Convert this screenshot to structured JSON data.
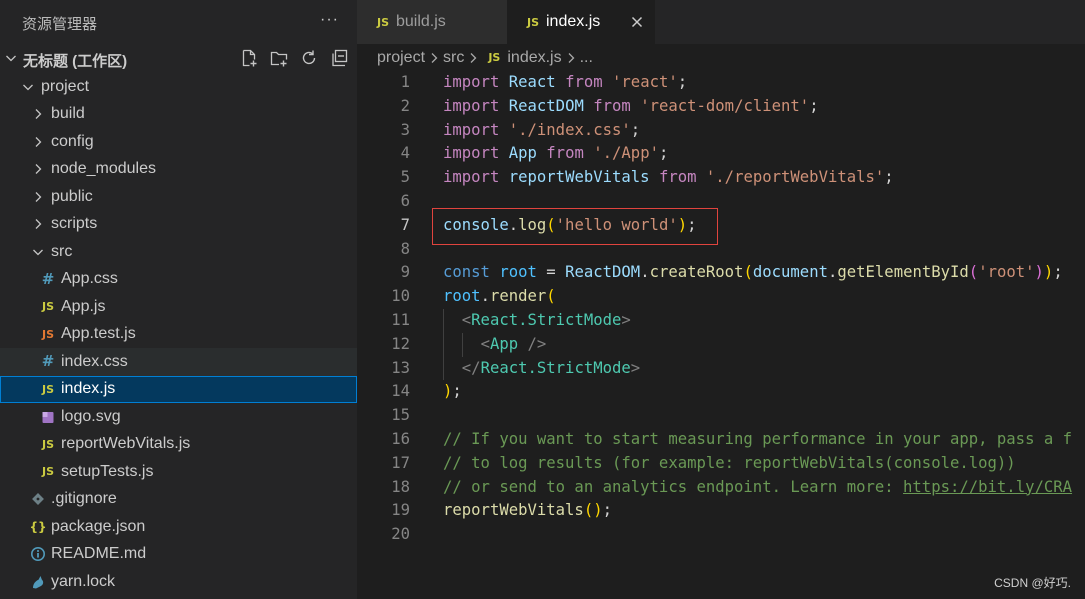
{
  "sidebar": {
    "title": "资源管理器",
    "more_label": "···",
    "workspace": {
      "label": "无标题 (工作区)",
      "expanded_icon": "chevron-down-icon",
      "actions": [
        "new-file-icon",
        "new-folder-icon",
        "refresh-icon",
        "collapse-all-icon"
      ]
    },
    "tree": [
      {
        "label": "project",
        "depth": 0,
        "icon": "chevron-down-icon"
      },
      {
        "label": "build",
        "depth": 1,
        "icon": "chevron-right-icon"
      },
      {
        "label": "config",
        "depth": 1,
        "icon": "chevron-right-icon"
      },
      {
        "label": "node_modules",
        "depth": 1,
        "icon": "chevron-right-icon"
      },
      {
        "label": "public",
        "depth": 1,
        "icon": "chevron-right-icon"
      },
      {
        "label": "scripts",
        "depth": 1,
        "icon": "chevron-right-icon"
      },
      {
        "label": "src",
        "depth": 1,
        "icon": "chevron-down-icon"
      },
      {
        "label": "App.css",
        "depth": 2,
        "icon": "css-icon"
      },
      {
        "label": "App.js",
        "depth": 2,
        "icon": "js-icon"
      },
      {
        "label": "App.test.js",
        "depth": 2,
        "icon": "js-test-icon"
      },
      {
        "label": "index.css",
        "depth": 2,
        "icon": "css-icon",
        "hovered": true
      },
      {
        "label": "index.js",
        "depth": 2,
        "icon": "js-icon",
        "selected": true
      },
      {
        "label": "logo.svg",
        "depth": 2,
        "icon": "svg-file-icon"
      },
      {
        "label": "reportWebVitals.js",
        "depth": 2,
        "icon": "js-icon"
      },
      {
        "label": "setupTests.js",
        "depth": 2,
        "icon": "js-icon"
      },
      {
        "label": ".gitignore",
        "depth": 1,
        "icon": "git-icon"
      },
      {
        "label": "package.json",
        "depth": 1,
        "icon": "json-icon"
      },
      {
        "label": "README.md",
        "depth": 1,
        "icon": "info-icon"
      },
      {
        "label": "yarn.lock",
        "depth": 1,
        "icon": "yarn-icon"
      }
    ]
  },
  "editor": {
    "tabs": [
      {
        "label": "build.js",
        "icon": "js-icon",
        "active": false
      },
      {
        "label": "index.js",
        "icon": "js-icon",
        "active": true
      }
    ],
    "breadcrumb": [
      {
        "label": "project"
      },
      {
        "label": "src"
      },
      {
        "label": "index.js",
        "icon": "js-icon"
      },
      {
        "label": "..."
      }
    ],
    "lines": [
      {
        "number": 1,
        "tokens": [
          [
            "import",
            "#c586c0"
          ],
          [
            " "
          ],
          [
            "React",
            "#9cdcfe"
          ],
          [
            " "
          ],
          [
            "from",
            "#c586c0"
          ],
          [
            " "
          ],
          [
            "'react'",
            "#ce9178"
          ],
          [
            ";"
          ]
        ]
      },
      {
        "number": 2,
        "tokens": [
          [
            "import",
            "#c586c0"
          ],
          [
            " "
          ],
          [
            "ReactDOM",
            "#9cdcfe"
          ],
          [
            " "
          ],
          [
            "from",
            "#c586c0"
          ],
          [
            " "
          ],
          [
            "'react-dom/client'",
            "#ce9178"
          ],
          [
            ";"
          ]
        ]
      },
      {
        "number": 3,
        "tokens": [
          [
            "import",
            "#c586c0"
          ],
          [
            " "
          ],
          [
            "'./index.css'",
            "#ce9178"
          ],
          [
            ";"
          ]
        ]
      },
      {
        "number": 4,
        "tokens": [
          [
            "import",
            "#c586c0"
          ],
          [
            " "
          ],
          [
            "App",
            "#9cdcfe"
          ],
          [
            " "
          ],
          [
            "from",
            "#c586c0"
          ],
          [
            " "
          ],
          [
            "'./App'",
            "#ce9178"
          ],
          [
            ";"
          ]
        ]
      },
      {
        "number": 5,
        "tokens": [
          [
            "import",
            "#c586c0"
          ],
          [
            " "
          ],
          [
            "reportWebVitals",
            "#9cdcfe"
          ],
          [
            " "
          ],
          [
            "from",
            "#c586c0"
          ],
          [
            " "
          ],
          [
            "'./reportWebVitals'",
            "#ce9178"
          ],
          [
            ";"
          ]
        ]
      },
      {
        "number": 6,
        "tokens": []
      },
      {
        "number": 7,
        "active": true,
        "tokens": [
          [
            "console",
            "#9cdcfe"
          ],
          [
            "."
          ],
          [
            "log",
            "#dcdcaa"
          ],
          [
            "(",
            "#ffd700"
          ],
          [
            "'hello world'",
            "#ce9178"
          ],
          [
            ")",
            "#ffd700"
          ],
          [
            ";"
          ]
        ]
      },
      {
        "number": 8,
        "tokens": []
      },
      {
        "number": 9,
        "tokens": [
          [
            "const",
            "#569cd6"
          ],
          [
            " "
          ],
          [
            "root",
            "#4fc1ff"
          ],
          [
            " = "
          ],
          [
            "ReactDOM",
            "#9cdcfe"
          ],
          [
            "."
          ],
          [
            "createRoot",
            "#dcdcaa"
          ],
          [
            "(",
            "#ffd700"
          ],
          [
            "document",
            "#9cdcfe"
          ],
          [
            "."
          ],
          [
            "getElementById",
            "#dcdcaa"
          ],
          [
            "(",
            "#da70d6"
          ],
          [
            "'root'",
            "#ce9178"
          ],
          [
            ")",
            "#da70d6"
          ],
          [
            ")",
            "#ffd700"
          ],
          [
            ";"
          ]
        ]
      },
      {
        "number": 10,
        "tokens": [
          [
            "root",
            "#4fc1ff"
          ],
          [
            "."
          ],
          [
            "render",
            "#dcdcaa"
          ],
          [
            "(",
            "#ffd700"
          ]
        ]
      },
      {
        "number": 11,
        "indent": 2,
        "tokens": [
          [
            "<",
            "#808080"
          ],
          [
            "React.StrictMode",
            "#4ec9b0"
          ],
          [
            ">",
            "#808080"
          ]
        ]
      },
      {
        "number": 12,
        "indent": 4,
        "tokens": [
          [
            "<",
            "#808080"
          ],
          [
            "App",
            "#4ec9b0"
          ],
          [
            " "
          ],
          [
            "/>",
            "#808080"
          ]
        ]
      },
      {
        "number": 13,
        "indent": 2,
        "tokens": [
          [
            "</",
            "#808080"
          ],
          [
            "React.StrictMode",
            "#4ec9b0"
          ],
          [
            ">",
            "#808080"
          ]
        ]
      },
      {
        "number": 14,
        "tokens": [
          [
            ")",
            "#ffd700"
          ],
          [
            ";"
          ]
        ]
      },
      {
        "number": 15,
        "tokens": []
      },
      {
        "number": 16,
        "tokens": [
          [
            "// If you want to start measuring performance in your app, pass a f",
            "#6a9955"
          ]
        ]
      },
      {
        "number": 17,
        "tokens": [
          [
            "// to log results (for example: reportWebVitals(console.log))",
            "#6a9955"
          ]
        ]
      },
      {
        "number": 18,
        "tokens": [
          [
            "// or send to an analytics endpoint. Learn more: ",
            "#6a9955"
          ],
          [
            "https://bit.ly/CRA",
            "#6a9955",
            true
          ]
        ]
      },
      {
        "number": 19,
        "tokens": [
          [
            "reportWebVitals",
            "#dcdcaa"
          ],
          [
            "(",
            "#ffd700"
          ],
          [
            ")",
            "#ffd700"
          ],
          [
            ";"
          ]
        ]
      },
      {
        "number": 20,
        "tokens": []
      }
    ]
  },
  "icon_styles": {
    "js-icon": {
      "glyph": "JS",
      "color": "#cbcb41"
    },
    "js-test-icon": {
      "glyph": "JS",
      "color": "#e37933"
    },
    "css-icon": {
      "glyph": "#",
      "color": "#519aba"
    },
    "json-icon": {
      "glyph": "{}",
      "color": "#cbcb41"
    },
    "svg-file-icon": {
      "color": "#a074c4"
    },
    "git-icon": {
      "color": "#6d8086"
    },
    "info-icon": {
      "color": "#519aba"
    },
    "yarn-icon": {
      "color": "#519aba"
    },
    "chevron-right-icon": {
      "color": "#c5c5c5"
    },
    "chevron-down-icon": {
      "color": "#c5c5c5"
    },
    "close-icon": {
      "color": "#cccccc"
    }
  },
  "colors": {
    "selection_bg": "#04395e",
    "selection_border": "#007fd4",
    "hover_bg": "#2a2d2e",
    "annotation_box": "#e0443e"
  },
  "watermark": "CSDN @好巧."
}
